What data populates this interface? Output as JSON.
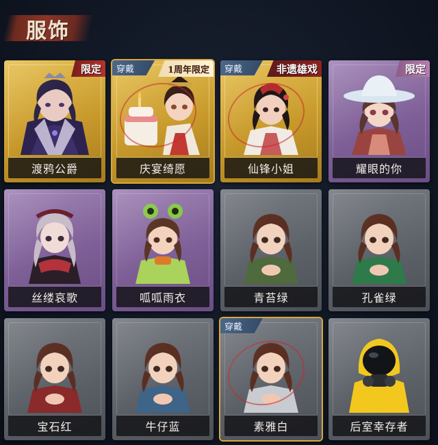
{
  "page": {
    "section_title": "服饰"
  },
  "cards": [
    {
      "name": "渡鸦公爵",
      "badge": "限定",
      "wearing": false
    },
    {
      "name": "庆宴绮愿",
      "badge": "1周年限定",
      "wearing": true,
      "wear_label": "穿戴"
    },
    {
      "name": "仙锋小姐",
      "badge": "非遗雄戏",
      "wearing": true,
      "wear_label": "穿戴"
    },
    {
      "name": "耀眼的你",
      "badge": "限定",
      "wearing": false
    },
    {
      "name": "丝缕哀歌"
    },
    {
      "name": "呱呱雨衣"
    },
    {
      "name": "青苔绿"
    },
    {
      "name": "孔雀绿"
    },
    {
      "name": "宝石红"
    },
    {
      "name": "牛仔蓝"
    },
    {
      "name": "素雅白",
      "wearing": true,
      "wear_label": "穿戴"
    },
    {
      "name": "后室幸存者"
    }
  ],
  "colors": {
    "background": "#101622",
    "gold_frame": "#c89a2c",
    "purple_frame": "#7e5f97",
    "gray_frame": "#5b5f66",
    "badge_red": "#b1342b",
    "wear_tag": "#3e5a7e"
  }
}
